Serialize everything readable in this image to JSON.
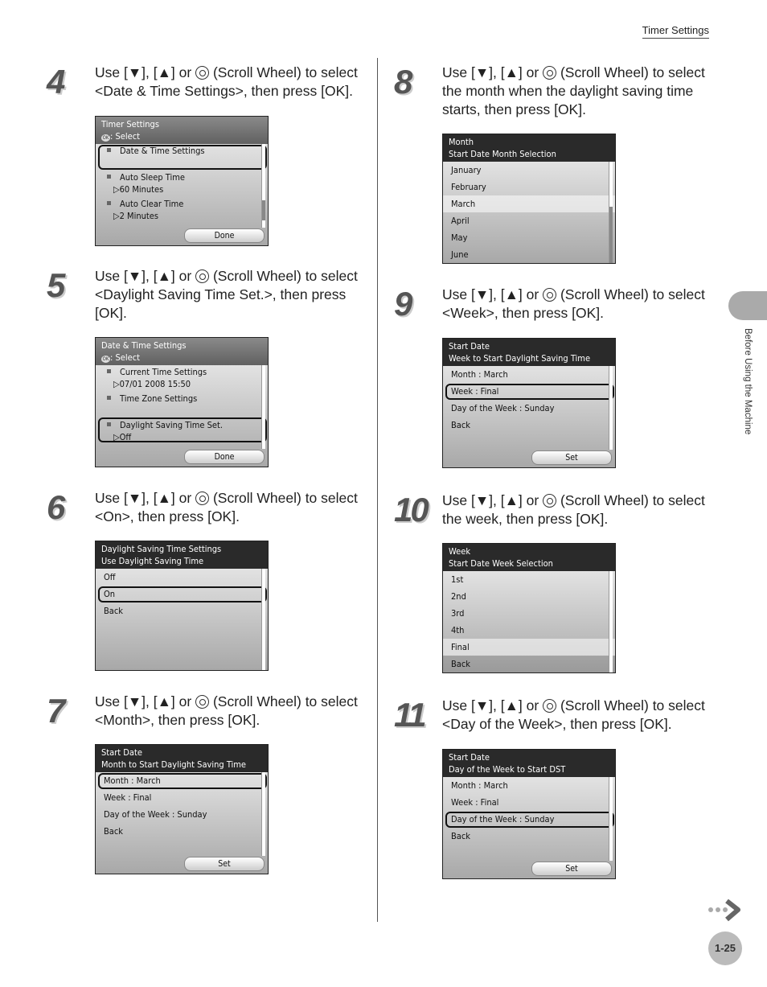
{
  "header": {
    "section": "Timer Settings"
  },
  "side_tab": "Before Using the Machine",
  "page_number": "1-25",
  "icons": {
    "scroll_wheel": "scroll-wheel-icon",
    "next": "next-page-arrow-icon",
    "ok": "ok-icon"
  },
  "ok_icon_text": "OK",
  "steps": [
    {
      "num": "4",
      "pre": "Use [▼], [▲] or ",
      "post": " (Scroll Wheel) to select <Date & Time Settings>, then press [OK].",
      "screen": {
        "style": "gray",
        "title": "Timer Settings",
        "subtitle": ": Select",
        "ok_icon": true,
        "items": [
          {
            "text": "Date & Time Settings",
            "sub": "",
            "bullet": true,
            "selected": true
          },
          {
            "text": "Auto Sleep Time",
            "sub": "▷60 Minutes",
            "bullet": true
          },
          {
            "text": "Auto Clear Time",
            "sub": "▷2 Minutes",
            "bullet": true
          }
        ],
        "button": "Done"
      }
    },
    {
      "num": "5",
      "pre": "Use [▼], [▲] or ",
      "post": " (Scroll Wheel) to select <Daylight Saving Time Set.>, then press [OK].",
      "screen": {
        "style": "gray",
        "title": "Date & Time Settings",
        "subtitle": ": Select",
        "ok_icon": true,
        "items": [
          {
            "text": "Current Time Settings",
            "sub": "▷07/01 2008  15:50",
            "bullet": true
          },
          {
            "text": "Time Zone Settings",
            "sub": "",
            "bullet": true
          },
          {
            "text": "Daylight Saving Time Set.",
            "sub": "▷Off",
            "bullet": true,
            "selected": true
          }
        ],
        "button": "Done"
      }
    },
    {
      "num": "6",
      "pre": "Use [▼], [▲] or ",
      "post": " (Scroll Wheel) to select <On>, then press [OK].",
      "screen": {
        "style": "dark",
        "title": "Daylight Saving Time Settings",
        "subtitle": "Use Daylight Saving Time",
        "items": [
          {
            "text": "Off"
          },
          {
            "text": "On",
            "selected": true
          },
          {
            "text": "Back"
          }
        ]
      }
    },
    {
      "num": "7",
      "pre": "Use [▼], [▲] or ",
      "post": " (Scroll Wheel) to select <Month>, then press [OK].",
      "screen": {
        "style": "dark",
        "title": "Start Date",
        "subtitle": "Month to Start Daylight Saving Time",
        "items": [
          {
            "text": "Month : March",
            "selected": true
          },
          {
            "text": "Week : Final"
          },
          {
            "text": "Day of the Week : Sunday"
          },
          {
            "text": "Back"
          }
        ],
        "button": "Set"
      }
    },
    {
      "num": "8",
      "pre": "Use [▼], [▲] or ",
      "post": " (Scroll Wheel) to select the month when the daylight saving time starts, then press [OK].",
      "screen": {
        "style": "dark",
        "title": "Month",
        "subtitle": "Start Date Month Selection",
        "items": [
          {
            "text": "January"
          },
          {
            "text": "February"
          },
          {
            "text": "March",
            "light": true
          },
          {
            "text": "April"
          },
          {
            "text": "May"
          },
          {
            "text": "June"
          }
        ]
      }
    },
    {
      "num": "9",
      "pre": "Use [▼], [▲] or ",
      "post": " (Scroll Wheel) to select <Week>, then press [OK].",
      "screen": {
        "style": "dark",
        "title": "Start Date",
        "subtitle": "Week to Start Daylight Saving Time",
        "items": [
          {
            "text": "Month : March"
          },
          {
            "text": "Week : Final",
            "selected": true
          },
          {
            "text": "Day of the Week : Sunday"
          },
          {
            "text": "Back"
          }
        ],
        "button": "Set"
      }
    },
    {
      "num": "10",
      "pre": " Use [▼], [▲] or ",
      "post": " (Scroll Wheel) to select the week, then press [OK].",
      "screen": {
        "style": "dark",
        "title": "Week",
        "subtitle": "Start Date Week Selection",
        "items": [
          {
            "text": "1st"
          },
          {
            "text": "2nd"
          },
          {
            "text": "3rd"
          },
          {
            "text": "4th"
          },
          {
            "text": "Final",
            "light": true
          },
          {
            "text": "Back",
            "darker": true
          }
        ]
      }
    },
    {
      "num": "11",
      "pre": "Use [▼], [▲] or ",
      "post": " (Scroll Wheel) to select <Day of the Week>, then press [OK].",
      "screen": {
        "style": "dark",
        "title": "Start Date",
        "subtitle": "Day of the Week to Start DST",
        "items": [
          {
            "text": "Month : March"
          },
          {
            "text": "Week : Final"
          },
          {
            "text": "Day of the Week : Sunday",
            "selected": true
          },
          {
            "text": "Back"
          }
        ],
        "button": "Set"
      }
    }
  ]
}
